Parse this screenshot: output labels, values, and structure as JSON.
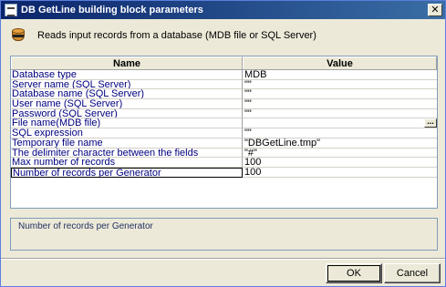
{
  "window": {
    "title": "DB GetLine building block parameters",
    "close_glyph": "✕"
  },
  "header": {
    "icon": "database-icon",
    "text": "Reads input records from a database (MDB file or SQL Server)"
  },
  "grid": {
    "columns": [
      "Name",
      "Value"
    ],
    "rows": [
      {
        "name": "Database type",
        "value": "MDB"
      },
      {
        "name": "Server name (SQL Server)",
        "value": "\"\""
      },
      {
        "name": "Database name (SQL Server)",
        "value": "\"\""
      },
      {
        "name": "User name (SQL Server)",
        "value": "\"\""
      },
      {
        "name": "Password (SQL Server)",
        "value": "\"\""
      },
      {
        "name": "File name(MDB file)",
        "value": ""
      },
      {
        "name": "SQL expression",
        "value": "\"\""
      },
      {
        "name": "Temporary file name",
        "value": "\"DBGetLine.tmp\""
      },
      {
        "name": "The delimiter character between the fields",
        "value": "\"#\""
      },
      {
        "name": "Max number of records",
        "value": "100"
      },
      {
        "name": "Number of records per Generator",
        "value": "100"
      }
    ],
    "browse_label": "..."
  },
  "description": "Number of records per Generator",
  "buttons": {
    "ok": "OK",
    "cancel": "Cancel"
  }
}
